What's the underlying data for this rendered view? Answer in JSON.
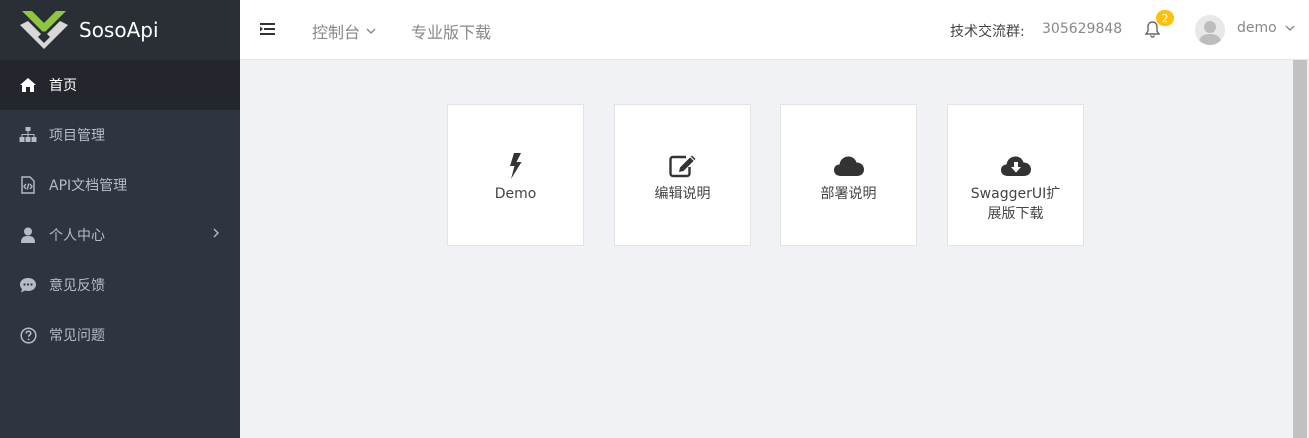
{
  "app": {
    "title": "SosoApi"
  },
  "sidebar": {
    "items": [
      {
        "label": "首页",
        "icon": "home-icon",
        "active": true
      },
      {
        "label": "项目管理",
        "icon": "sitemap-icon"
      },
      {
        "label": "API文档管理",
        "icon": "file-code-icon"
      },
      {
        "label": "个人中心",
        "icon": "user-icon",
        "has_submenu": true
      },
      {
        "label": "意见反馈",
        "icon": "comment-icon"
      },
      {
        "label": "常见问题",
        "icon": "question-circle-icon"
      }
    ]
  },
  "header": {
    "console_label": "控制台",
    "pro_download_label": "专业版下载",
    "group_label": "技术交流群:",
    "group_number": "305629848",
    "notification_count": "2",
    "username": "demo"
  },
  "cards": [
    {
      "label": "Demo",
      "icon": "bolt-icon"
    },
    {
      "label": "编辑说明",
      "icon": "edit-icon"
    },
    {
      "label": "部署说明",
      "icon": "cloud-icon"
    },
    {
      "label": "SwaggerUI扩展版下载",
      "icon": "cloud-download-icon"
    }
  ],
  "colors": {
    "sidebar_bg": "#2f3540",
    "sidebar_active_bg": "#23272d",
    "logo_accent": "#8dc63f",
    "badge": "#ffc107"
  }
}
